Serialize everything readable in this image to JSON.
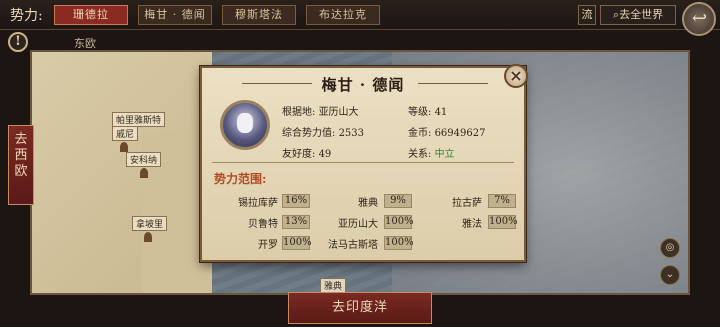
{
  "topbar": {
    "faction_label": "势力:",
    "tabs": [
      "珊德拉",
      "梅甘 · 德闻",
      "穆斯塔法",
      "布达拉克"
    ],
    "active_tab": 0,
    "flow_btn": "流",
    "world_btn": "去全世界"
  },
  "region": "东欧",
  "map": {
    "cities": [
      "帕里雅斯特",
      "戚尼",
      "安科纳",
      "拿坡里",
      "雅典"
    ],
    "west_btn": "去西欧",
    "india_btn": "去印度洋"
  },
  "panel": {
    "title": "梅甘 · 德闻",
    "base_label": "根据地:",
    "base_value": "亚历山大",
    "level_label": "等级:",
    "level_value": "41",
    "power_label": "综合势力值:",
    "power_value": "2533",
    "gold_label": "金币:",
    "gold_value": "66949627",
    "friend_label": "友好度:",
    "friend_value": "49",
    "relation_label": "关系:",
    "relation_value": "中立",
    "sphere_title": "势力范围:",
    "sphere": [
      {
        "name": "锡拉库萨",
        "pct": "16%"
      },
      {
        "name": "雅典",
        "pct": "9%"
      },
      {
        "name": "拉古萨",
        "pct": "7%"
      },
      {
        "name": "贝鲁特",
        "pct": "13%"
      },
      {
        "name": "亚历山大",
        "pct": "100%"
      },
      {
        "name": "雅法",
        "pct": "100%"
      },
      {
        "name": "开罗",
        "pct": "100%"
      },
      {
        "name": "法马古斯塔",
        "pct": "100%"
      }
    ]
  },
  "colors": {
    "accent": "#8a2a22",
    "relation_neutral": "#2e8a34"
  }
}
